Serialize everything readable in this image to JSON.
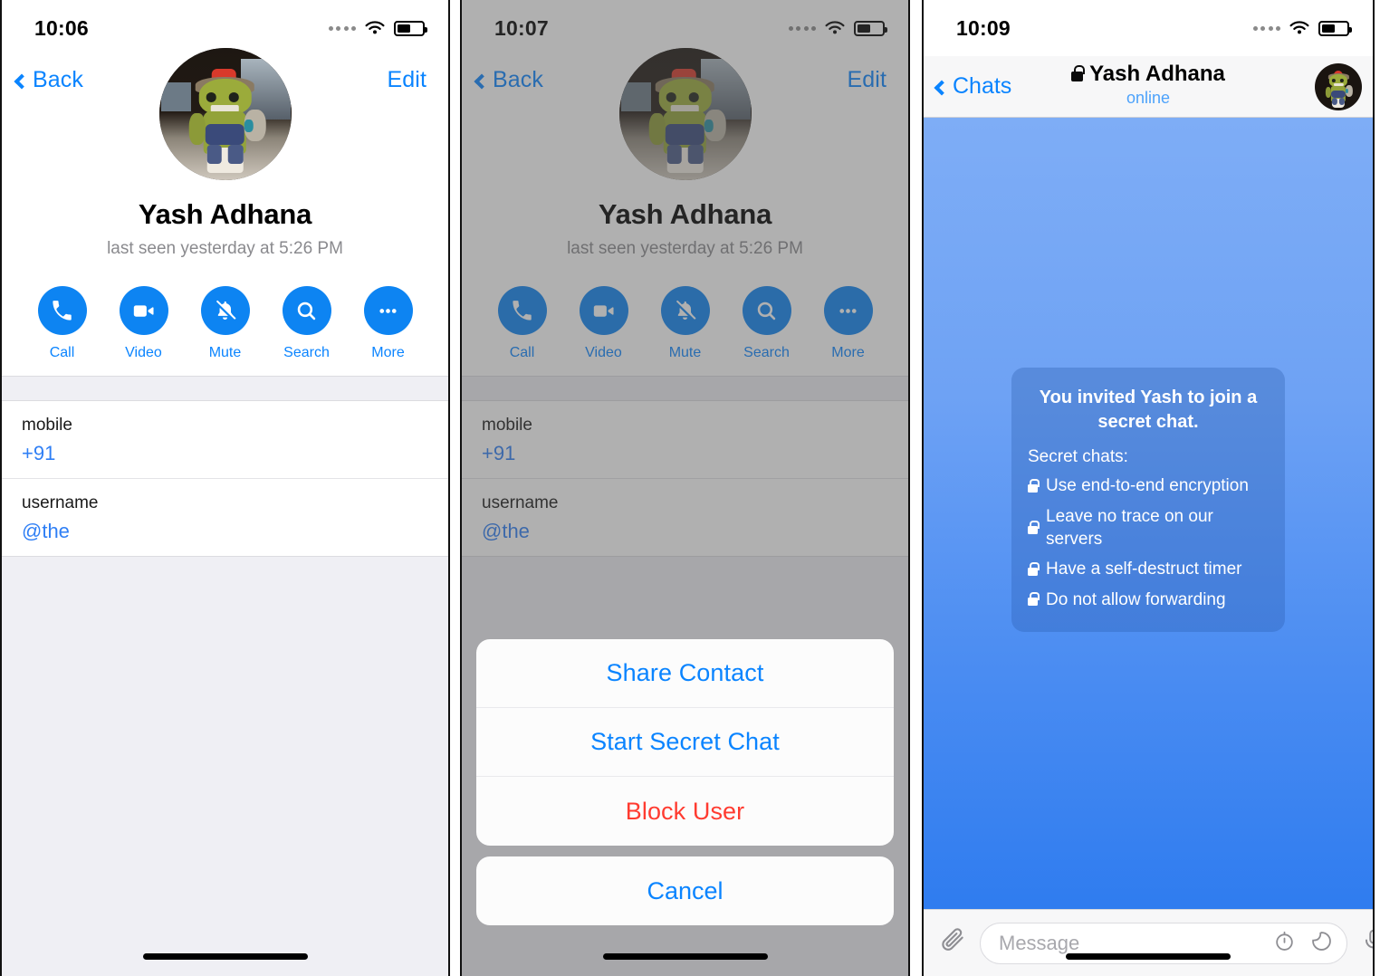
{
  "panels": [
    {
      "id": "contact-profile",
      "status_bar": {
        "time": "10:06",
        "wifi": "wifi-icon",
        "battery": "battery-icon",
        "signal": "signal-dots-icon"
      },
      "nav": {
        "back_label": "Back",
        "edit_label": "Edit"
      },
      "profile": {
        "name": "Yash Adhana",
        "status": "last seen yesterday at 5:26 PM",
        "avatar": "contact-avatar"
      },
      "actions": [
        {
          "label": "Call",
          "icon": "phone-icon"
        },
        {
          "label": "Video",
          "icon": "video-camera-icon"
        },
        {
          "label": "Mute",
          "icon": "bell-muted-icon"
        },
        {
          "label": "Search",
          "icon": "search-icon"
        },
        {
          "label": "More",
          "icon": "ellipsis-icon"
        }
      ],
      "info_rows": [
        {
          "key": "mobile",
          "value": "+91"
        },
        {
          "key": "username",
          "value": "@the"
        }
      ]
    },
    {
      "id": "contact-profile-action-sheet",
      "status_bar": {
        "time": "10:07"
      },
      "nav": {
        "back_label": "Back",
        "edit_label": "Edit"
      },
      "profile": {
        "name": "Yash Adhana",
        "status": "last seen yesterday at 5:26 PM",
        "avatar": "contact-avatar"
      },
      "actions": [
        {
          "label": "Call",
          "icon": "phone-icon"
        },
        {
          "label": "Video",
          "icon": "video-camera-icon"
        },
        {
          "label": "Mute",
          "icon": "bell-muted-icon"
        },
        {
          "label": "Search",
          "icon": "search-icon"
        },
        {
          "label": "More",
          "icon": "ellipsis-icon"
        }
      ],
      "info_rows": [
        {
          "key": "mobile",
          "value": "+91"
        },
        {
          "key": "username",
          "value": "@the"
        }
      ],
      "action_sheet": {
        "items": [
          {
            "label": "Share Contact",
            "style": "default"
          },
          {
            "label": "Start Secret Chat",
            "style": "default"
          },
          {
            "label": "Block User",
            "style": "destructive"
          }
        ],
        "cancel_label": "Cancel"
      }
    },
    {
      "id": "secret-chat",
      "status_bar": {
        "time": "10:09"
      },
      "nav": {
        "back_label": "Chats",
        "title": "Yash Adhana",
        "title_lock_icon": "lock-icon",
        "subtitle": "online",
        "avatar": "contact-avatar"
      },
      "secret_notice": {
        "title": "You invited Yash to join a secret chat.",
        "subtitle": "Secret chats:",
        "bullets": [
          "Use end-to-end encryption",
          "Leave no trace on our servers",
          "Have a self-destruct timer",
          "Do not allow forwarding"
        ]
      },
      "composer": {
        "attach_icon": "paperclip-icon",
        "placeholder": "Message",
        "value": "",
        "timer_icon": "self-destruct-timer-icon",
        "sticker_icon": "sticker-icon",
        "mic_icon": "microphone-icon"
      }
    }
  ],
  "colors": {
    "accent_blue": "#0a84ff",
    "action_circle_blue": "#0d84f2",
    "destructive_red": "#ff3b30",
    "chat_bg_top": "#7eadf6",
    "chat_bg_bottom": "#2f7cef",
    "bubble": "#4a84d4",
    "list_bg": "#efeff4",
    "muted_text": "#8a8a8e"
  }
}
